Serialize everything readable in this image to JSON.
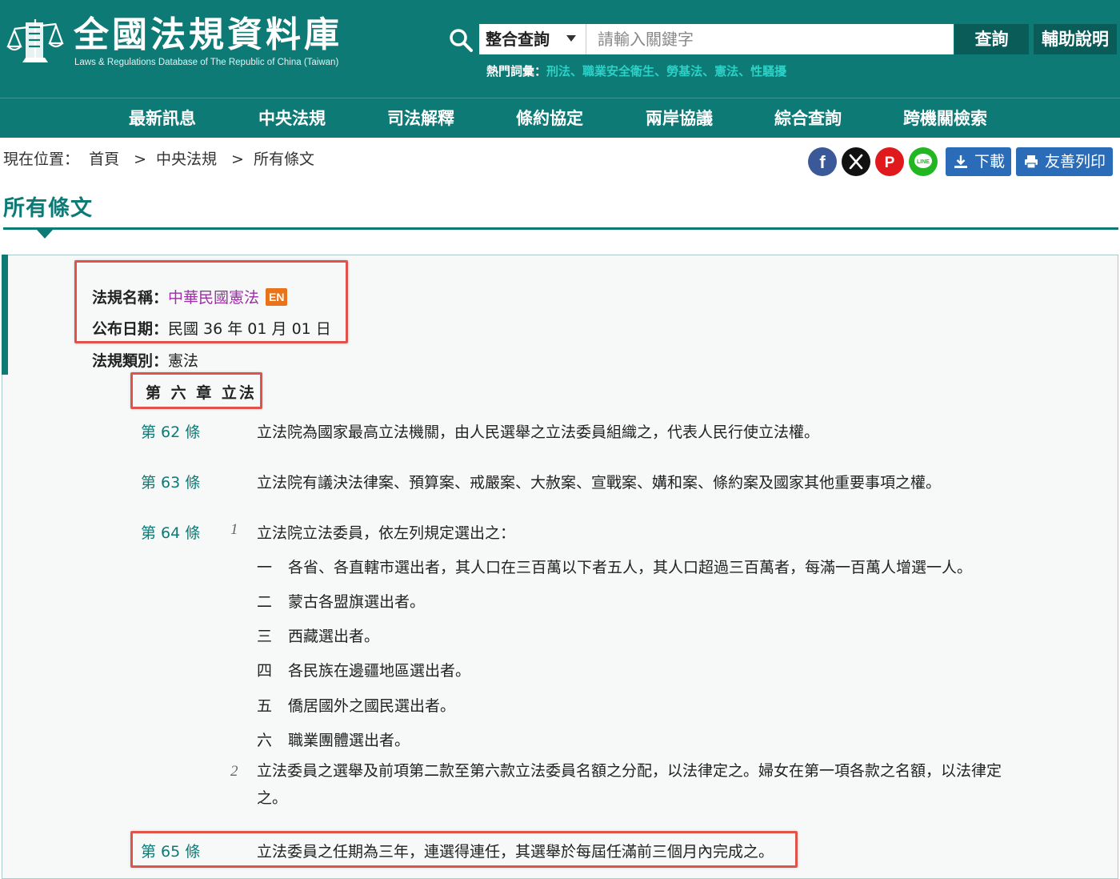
{
  "header": {
    "site_title": "全國法規資料庫",
    "site_subtitle": "Laws & Regulations Database of The Republic of China (Taiwan)",
    "search": {
      "scope_selected": "整合查詢",
      "placeholder": "請輸入關鍵字",
      "search_button": "查詢",
      "help_button": "輔助說明"
    },
    "hot_terms_label": "熱門詞彙：",
    "hot_terms": [
      "刑法",
      "職業安全衛生",
      "勞基法",
      "憲法",
      "性騷擾"
    ],
    "hot_terms_separator": "、"
  },
  "nav": [
    "最新訊息",
    "中央法規",
    "司法解釋",
    "條約協定",
    "兩岸協議",
    "綜合查詢",
    "跨機關檢索"
  ],
  "breadcrumb": {
    "label": "現在位置：",
    "items": [
      "首頁",
      "中央法規",
      "所有條文"
    ],
    "separator": ">"
  },
  "share_icons": [
    "facebook-icon",
    "x-icon",
    "plurk-icon",
    "line-icon"
  ],
  "share_glyphs": {
    "facebook": "f",
    "x": "𝕏",
    "plurk": "P",
    "line": "LINE"
  },
  "actions": {
    "download": "下載",
    "print": "友善列印"
  },
  "page_title": "所有條文",
  "law": {
    "name_label": "法規名稱：",
    "name": "中華民國憲法",
    "en_badge": "EN",
    "date_label": "公布日期：",
    "date": "民國 36 年 01 月 01 日",
    "category_label": "法規類別：",
    "category": "憲法"
  },
  "chapter": "第 六 章 立法",
  "articles": {
    "a62": {
      "no": "第 62 條",
      "text": "立法院為國家最高立法機關，由人民選舉之立法委員組織之，代表人民行使立法權。"
    },
    "a63": {
      "no": "第 63 條",
      "text": "立法院有議決法律案、預算案、戒嚴案、大赦案、宣戰案、媾和案、條約案及國家其他重要事項之權。"
    },
    "a64": {
      "no": "第 64 條",
      "p1_no": "1",
      "p1_text": "立法院立法委員，依左列規定選出之：",
      "items": [
        {
          "no": "一",
          "text": "各省、各直轄市選出者，其人口在三百萬以下者五人，其人口超過三百萬者，每滿一百萬人增選一人。"
        },
        {
          "no": "二",
          "text": "蒙古各盟旗選出者。"
        },
        {
          "no": "三",
          "text": "西藏選出者。"
        },
        {
          "no": "四",
          "text": "各民族在邊疆地區選出者。"
        },
        {
          "no": "五",
          "text": "僑居國外之國民選出者。"
        },
        {
          "no": "六",
          "text": "職業團體選出者。"
        }
      ],
      "p2_no": "2",
      "p2_text": "立法委員之選舉及前項第二款至第六款立法委員名額之分配，以法律定之。婦女在第一項各款之名額，以法律定之。"
    },
    "a65": {
      "no": "第 65 條",
      "text": "立法委員之任期為三年，連選得連任，其選舉於每屆任滿前三個月內完成之。"
    }
  },
  "colors": {
    "brand_teal": "#0d7a76",
    "hot_term_link": "#2bd1c6",
    "law_name_link": "#9b2fa4",
    "en_badge": "#e8731a",
    "action_button": "#2b6cb8",
    "highlight_box": "#e0524a"
  }
}
